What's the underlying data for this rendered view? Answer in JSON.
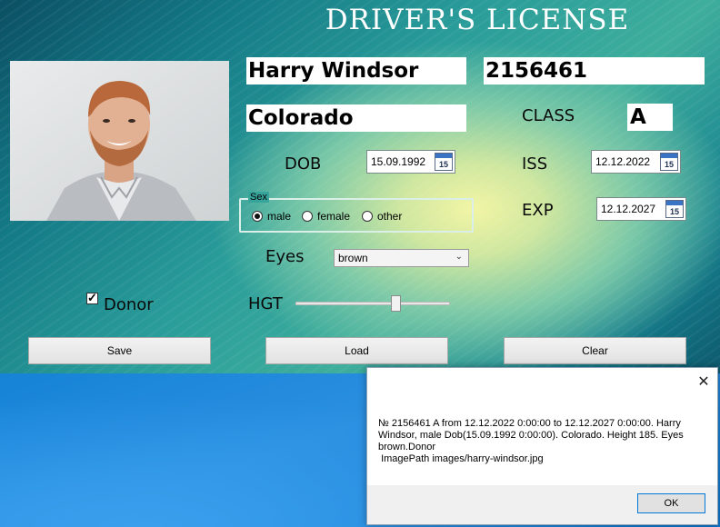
{
  "form": {
    "title": "DRIVER'S LICENSE",
    "name": "Harry Windsor",
    "license_number": "2156461",
    "state": "Colorado",
    "class_label": "CLASS",
    "class_value": "A",
    "dob_label": "DOB",
    "dob_value": "15.09.1992",
    "iss_label": "ISS",
    "iss_value": "12.12.2022",
    "exp_label": "EXP",
    "exp_value": "12.12.2027",
    "calendar_icon_day": "15",
    "sex": {
      "legend": "Sex",
      "options": [
        "male",
        "female",
        "other"
      ],
      "selected": "male"
    },
    "eyes_label": "Eyes",
    "eyes_value": "brown",
    "donor_label": "Donor",
    "donor_checked": true,
    "hgt_label": "HGT",
    "hgt_level": 0.66,
    "buttons": {
      "save": "Save",
      "load": "Load",
      "clear": "Clear"
    }
  },
  "messagebox": {
    "text": "№ 2156461 A from 12.12.2022 0:00:00 to 12.12.2027 0:00:00. Harry Windsor, male Dob(15.09.1992 0:00:00). Colorado. Height 185. Eyes brown.Donor\n ImagePath images/harry-windsor.jpg",
    "ok": "OK",
    "close_glyph": "✕"
  },
  "icons": [
    "calendar-icon",
    "close-icon",
    "chevron-down-icon",
    "checkmark-icon"
  ]
}
